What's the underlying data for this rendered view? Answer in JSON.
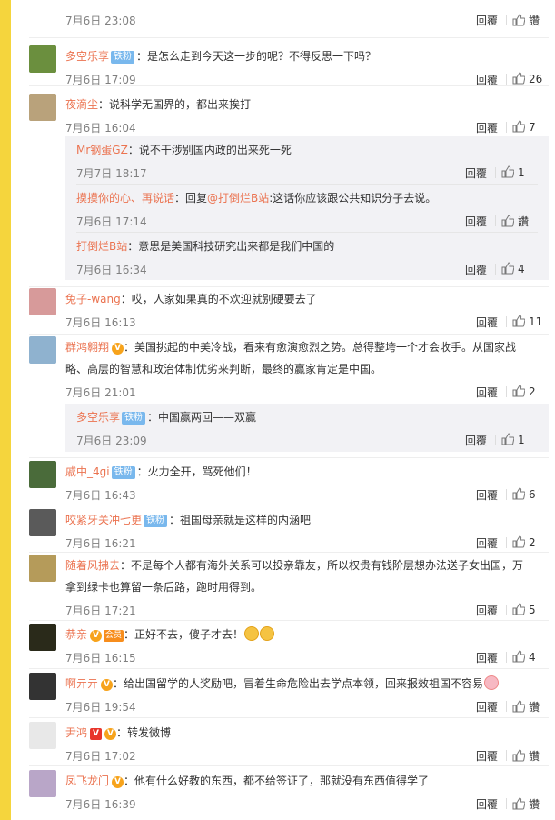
{
  "reply_label": "回覆",
  "like_label": "讚",
  "comments": [
    {
      "user": "",
      "badge": "",
      "text": "",
      "time": "7月6日 23:08",
      "likes": "讚",
      "avatar_color": "#ccc"
    },
    {
      "user": "多空乐享",
      "badge": "铁粉",
      "text": "：是怎么走到今天这一步的呢？不得反思一下吗？",
      "time": "7月6日 17:09",
      "likes": "26",
      "avatar_color": "#6b8f3e"
    },
    {
      "user": "夜滴尘",
      "badge": "",
      "text": "：说科学无国界的，都出来挨打",
      "time": "7月6日 16:04",
      "likes": "7",
      "avatar_color": "#b9a27b"
    },
    {
      "user": "兔子-wang",
      "badge": "",
      "text": "：哎，人家如果真的不欢迎就别硬要去了",
      "time": "7月6日 16:13",
      "likes": "11",
      "avatar_color": "#d79a9a"
    },
    {
      "user": "群鸿翱翔",
      "badge": "",
      "text1": "：美国挑起的中美冷战，看来有愈演愈烈之势。总得整垮一个才会收手。从国家战",
      "text2": "略、高层的智慧和政治体制优劣来判断，最终的赢家肯定是中国。",
      "time": "7月6日 21:01",
      "likes": "2",
      "avatar_color": "#8fb2cf"
    },
    {
      "user": "戚中_4gi",
      "badge": "铁粉",
      "text": "：火力全开，骂死他们！",
      "time": "7月6日 16:43",
      "likes": "6",
      "avatar_color": "#4a6b3a"
    },
    {
      "user": "咬紧牙关冲七更",
      "badge": "铁粉",
      "text": "：祖国母亲就是这样的内涵吧",
      "time": "7月6日 16:21",
      "likes": "2",
      "avatar_color": "#5a5a5a"
    },
    {
      "user": "随着风拂去",
      "badge": "",
      "text1": "：不是每个人都有海外关系可以投亲靠友，所以权贵有钱阶层想办法送子女出国，万一",
      "text2": "拿到绿卡也算留一条后路，跑时用得到。",
      "time": "7月6日 17:21",
      "likes": "5",
      "avatar_color": "#b59b5a"
    },
    {
      "user": "恭亲",
      "badge": "",
      "text": "：正好不去，傻子才去！",
      "time": "7月6日 16:15",
      "likes": "4",
      "avatar_color": "#2a2a1a"
    },
    {
      "user": "啊亓亓",
      "badge": "",
      "text": "：给出国留学的人奖励吧，冒着生命危险出去学点本领，回来报效祖国不容易",
      "time": "7月6日 19:54",
      "likes": "讚",
      "avatar_color": "#333"
    },
    {
      "user": "尹鸿",
      "badge": "",
      "text": "：转发微博",
      "time": "7月6日 17:02",
      "likes": "讚",
      "avatar_color": "#e8e8e8"
    },
    {
      "user": "凤飞龙门",
      "badge": "",
      "text": "：他有什么好教的东西，都不给签证了，那就没有东西值得学了",
      "time": "7月6日 16:39",
      "likes": "讚",
      "avatar_color": "#b9a6c8"
    }
  ],
  "sub1": [
    {
      "user": "Mr钢蛋GZ",
      "text": "：说不干涉别国内政的出来死一死",
      "time": "7月7日 18:17",
      "likes": "1"
    },
    {
      "user": "摸摸你的心、再说话",
      "text_pre": "：回复",
      "mention": "@打倒烂B站",
      "text": ":这话你应该跟公共知识分子去说。",
      "time": "7月6日 17:14",
      "likes": "讚"
    },
    {
      "user": "打倒烂B站",
      "text": "：意思是美国科技研究出来都是我们中国的",
      "time": "7月6日 16:34",
      "likes": "4"
    }
  ],
  "sub2": [
    {
      "user": "多空乐享",
      "badge": "铁粉",
      "text": "：中国赢两回——双赢",
      "time": "7月6日 23:09",
      "likes": "1"
    }
  ],
  "vip_label": "会员",
  "v_label": "V"
}
